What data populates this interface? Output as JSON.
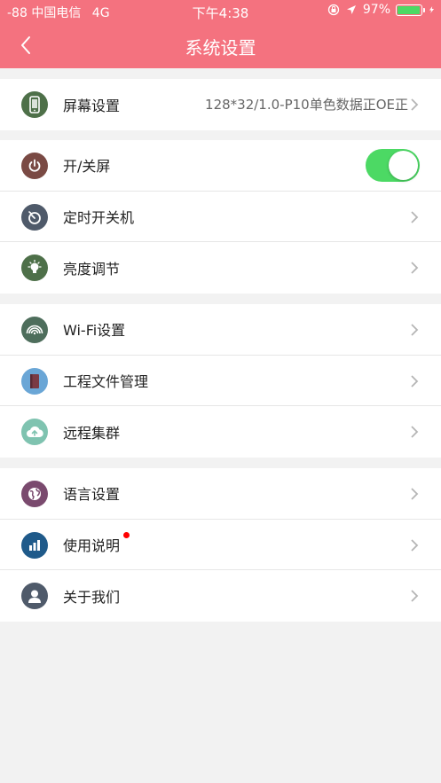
{
  "status_bar": {
    "signal": "-88",
    "carrier": "中国电信",
    "network": "4G",
    "time": "下午4:38",
    "battery_percent": "97%",
    "battery_level": 0.97,
    "battery_color": "#4cd964"
  },
  "nav": {
    "title": "系统设置",
    "back_icon": "chevron-left-icon"
  },
  "theme": {
    "header_bg": "#f4727f",
    "toggle_on": "#4cd964"
  },
  "groups": [
    {
      "items": [
        {
          "label": "屏幕设置",
          "value": "128*32/1.0-P10单色数据正OE正",
          "icon": "phone-screen-icon",
          "icon_color": "#4e7049"
        }
      ]
    },
    {
      "items": [
        {
          "label": "开/关屏",
          "icon": "power-icon",
          "icon_color": "#7a4a44",
          "toggle_on": true
        },
        {
          "label": "定时开关机",
          "icon": "timer-icon",
          "icon_color": "#4f5a6a"
        },
        {
          "label": "亮度调节",
          "icon": "bulb-icon",
          "icon_color": "#4e7049"
        }
      ]
    },
    {
      "items": [
        {
          "label": "Wi-Fi设置",
          "icon": "wifi-icon",
          "icon_color": "#4e6e5c"
        },
        {
          "label": "工程文件管理",
          "icon": "book-icon",
          "icon_color": "#6aa6d6"
        },
        {
          "label": "远程集群",
          "icon": "cloud-upload-icon",
          "icon_color": "#7fc3b0"
        }
      ]
    },
    {
      "items": [
        {
          "label": "语言设置",
          "icon": "globe-icon",
          "icon_color": "#7a4a6e"
        },
        {
          "label": "使用说明",
          "icon": "chart-icon",
          "icon_color": "#1f5a8a",
          "badge": true
        },
        {
          "label": "关于我们",
          "icon": "user-icon",
          "icon_color": "#4f5a6a"
        }
      ]
    }
  ]
}
